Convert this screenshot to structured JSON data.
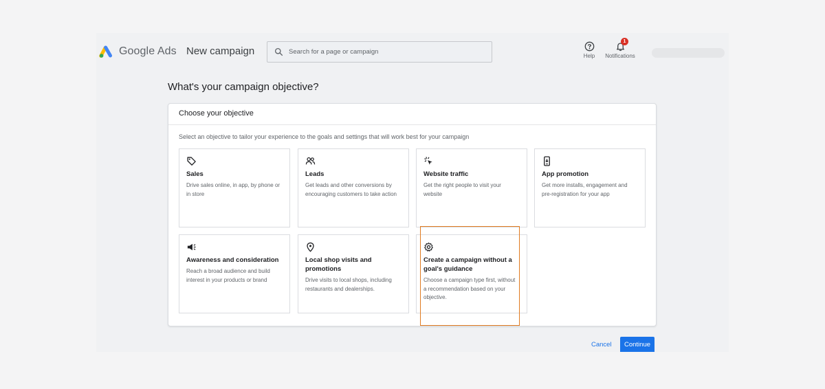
{
  "header": {
    "brand": "Google Ads",
    "page_title": "New campaign",
    "search_placeholder": "Search for a page or campaign",
    "help_label": "Help",
    "notifications_label": "Notifications",
    "notifications_count": "1"
  },
  "main": {
    "heading": "What's your campaign objective?",
    "panel_title": "Choose your objective",
    "panel_description": "Select an objective to tailor your experience to the goals and settings that will work best for your campaign",
    "objectives": [
      {
        "title": "Sales",
        "description": "Drive sales online, in app, by phone or in store",
        "icon": "tag-icon"
      },
      {
        "title": "Leads",
        "description": "Get leads and other conversions by encouraging customers to take action",
        "icon": "people-icon"
      },
      {
        "title": "Website traffic",
        "description": "Get the right people to visit your website",
        "icon": "cursor-click-icon"
      },
      {
        "title": "App promotion",
        "description": "Get more installs, engagement and pre-registration for your app",
        "icon": "phone-icon"
      },
      {
        "title": "Awareness and consideration",
        "description": "Reach a broad audience and build interest in your products or brand",
        "icon": "megaphone-icon"
      },
      {
        "title": "Local shop visits and promotions",
        "description": "Drive visits to local shops, including restaurants and dealerships.",
        "icon": "location-pin-icon"
      },
      {
        "title": "Create a campaign without a goal's guidance",
        "description": "Choose a campaign type first, without a recommendation based on your objective.",
        "icon": "gear-icon"
      }
    ]
  },
  "footer": {
    "cancel_label": "Cancel",
    "continue_label": "Continue"
  },
  "colors": {
    "accent": "#1a73e8",
    "highlight": "#e07a1f",
    "badge": "#d93025"
  }
}
